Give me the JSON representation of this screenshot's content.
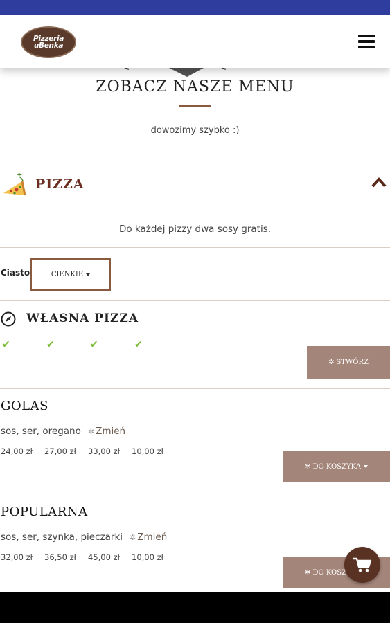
{
  "header": {
    "logo_line1": "Pizzeria",
    "logo_line2": "uBenka"
  },
  "menu": {
    "title": "ZOBACZ NASZE MENU",
    "subtitle": "dowozimy szybko :)"
  },
  "category": {
    "title": "PIZZA",
    "note": "Do każdej pizzy dwa sosy gratis."
  },
  "crust": {
    "label": "Ciasto",
    "selected": "CIENKIE"
  },
  "own_pizza": {
    "title": "WŁASNA PIZZA",
    "checks": [
      "✔",
      "✔",
      "✔",
      "✔"
    ],
    "button_label": "STWÓRZ"
  },
  "items": [
    {
      "title": "GOLAS",
      "description": "sos, ser, oregano",
      "change_label": "Zmień",
      "prices": [
        "24,00 zł",
        "27,00 zł",
        "33,00 zł",
        "10,00 zł"
      ],
      "button_label": "DO KOSZYKA"
    },
    {
      "title": "POPULARNA",
      "description": "sos, ser, szynka, pieczarki",
      "change_label": "Zmień",
      "prices": [
        "32,00 zł",
        "36,50 zł",
        "45,00 zł",
        "10,00 zł"
      ],
      "button_label": "DO KOSZYKA"
    }
  ],
  "colors": {
    "status_bar": "#2f3e9e",
    "brand_brown": "#6b2e20",
    "button_bg": "#a38579",
    "check_green": "#74b82a",
    "fab_bg": "#5a3224"
  },
  "icons": {
    "menu": "hamburger-icon",
    "pizza": "pizza-slice-icon",
    "collapse": "chevron-up-icon",
    "own_pizza": "compass-icon",
    "loading": "spinner-icon",
    "cart": "cart-icon"
  }
}
